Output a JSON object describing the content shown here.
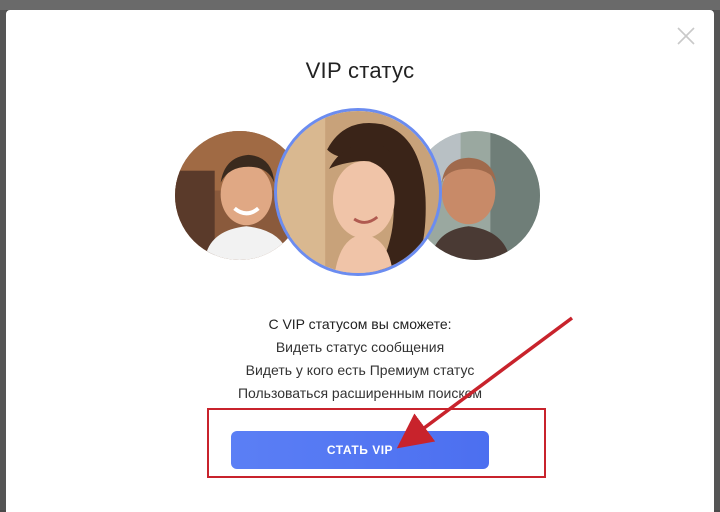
{
  "modal": {
    "title": "VIP статус",
    "close_icon": "close-icon"
  },
  "avatars": [
    {
      "name": "avatar-left",
      "description_icon": "user-photo"
    },
    {
      "name": "avatar-center",
      "description_icon": "user-photo"
    },
    {
      "name": "avatar-right",
      "description_icon": "user-photo"
    }
  ],
  "features": {
    "heading": "С VIP статусом вы сможете:",
    "items": [
      "Видеть статус сообщения",
      "Видеть у кого есть Премиум статус",
      "Пользоваться расширенным поиском"
    ]
  },
  "cta": {
    "label": "СТАТЬ VIP"
  },
  "colors": {
    "accent": "#5b7ff5",
    "annotation": "#c8232c",
    "avatar_ring": "#6b8cf0"
  }
}
